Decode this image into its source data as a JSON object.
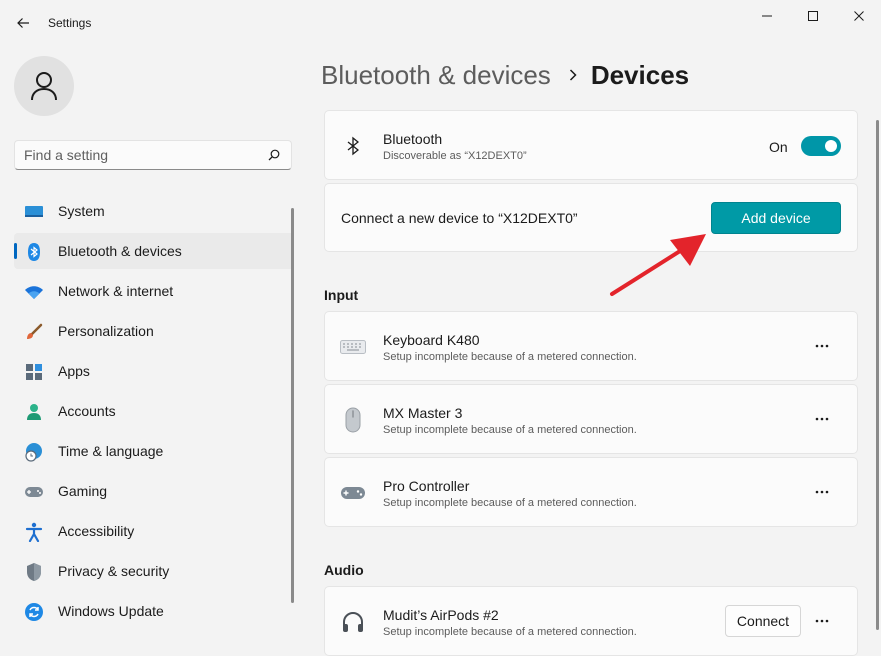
{
  "window": {
    "title": "Settings"
  },
  "search": {
    "placeholder": "Find a setting"
  },
  "sidebar": {
    "items": [
      {
        "label": "System",
        "icon": "system-icon"
      },
      {
        "label": "Bluetooth & devices",
        "icon": "bluetooth-icon",
        "active": true
      },
      {
        "label": "Network & internet",
        "icon": "wifi-icon"
      },
      {
        "label": "Personalization",
        "icon": "brush-icon"
      },
      {
        "label": "Apps",
        "icon": "apps-icon"
      },
      {
        "label": "Accounts",
        "icon": "accounts-icon"
      },
      {
        "label": "Time & language",
        "icon": "globe-clock-icon"
      },
      {
        "label": "Gaming",
        "icon": "gamepad-icon"
      },
      {
        "label": "Accessibility",
        "icon": "accessibility-icon"
      },
      {
        "label": "Privacy & security",
        "icon": "shield-icon"
      },
      {
        "label": "Windows Update",
        "icon": "update-icon"
      }
    ]
  },
  "breadcrumb": {
    "parent": "Bluetooth & devices",
    "current": "Devices"
  },
  "bluetooth": {
    "title": "Bluetooth",
    "subtitle": "Discoverable as “X12DEXT0”",
    "toggle_label": "On",
    "enabled": true
  },
  "connect": {
    "text": "Connect a new device to “X12DEXT0”",
    "button_label": "Add device"
  },
  "sections": {
    "input": "Input",
    "audio": "Audio"
  },
  "input_devices": [
    {
      "name": "Keyboard K480",
      "status": "Setup incomplete because of a metered connection.",
      "icon": "keyboard-icon"
    },
    {
      "name": "MX Master 3",
      "status": "Setup incomplete because of a metered connection.",
      "icon": "mouse-icon"
    },
    {
      "name": "Pro Controller",
      "status": "Setup incomplete because of a metered connection.",
      "icon": "gamepad-icon"
    }
  ],
  "audio_devices": [
    {
      "name": "Mudit’s AirPods #2",
      "status": "Setup incomplete because of a metered connection.",
      "icon": "headphones-icon",
      "button_label": "Connect"
    }
  ],
  "colors": {
    "accent": "#009aa6",
    "toggle_on": "#0096a8",
    "nav_indicator": "#0067c0",
    "annotation_arrow": "#e3242b"
  }
}
